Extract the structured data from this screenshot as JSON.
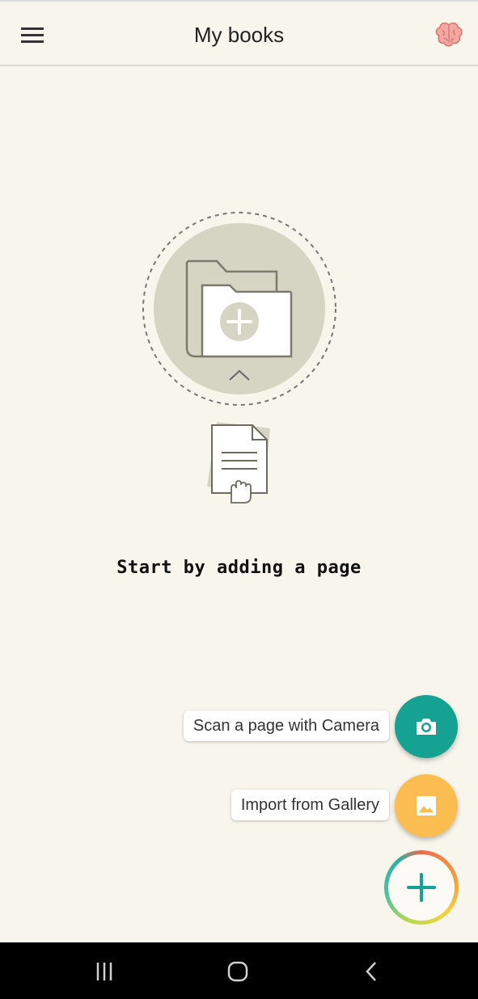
{
  "header": {
    "title": "My books",
    "menu_icon": "hamburger-menu-icon",
    "brain_icon": "brain-icon"
  },
  "empty_state": {
    "message": "Start by adding a page",
    "illustration_icon": "add-folder-icon",
    "document_icon": "document-hand-icon"
  },
  "actions": {
    "camera_label": "Scan a page with Camera",
    "gallery_label": "Import from Gallery",
    "camera_icon": "camera-icon",
    "gallery_icon": "image-icon",
    "add_icon": "plus-icon"
  },
  "colors": {
    "background": "#f8f5ec",
    "camera_fab": "#16a293",
    "gallery_fab": "#fbbd50",
    "accent": "#16a293",
    "illustration_fill": "#d6d4c2"
  },
  "navbar": {
    "recents_icon": "recents-icon",
    "home_icon": "home-icon",
    "back_icon": "back-icon"
  }
}
